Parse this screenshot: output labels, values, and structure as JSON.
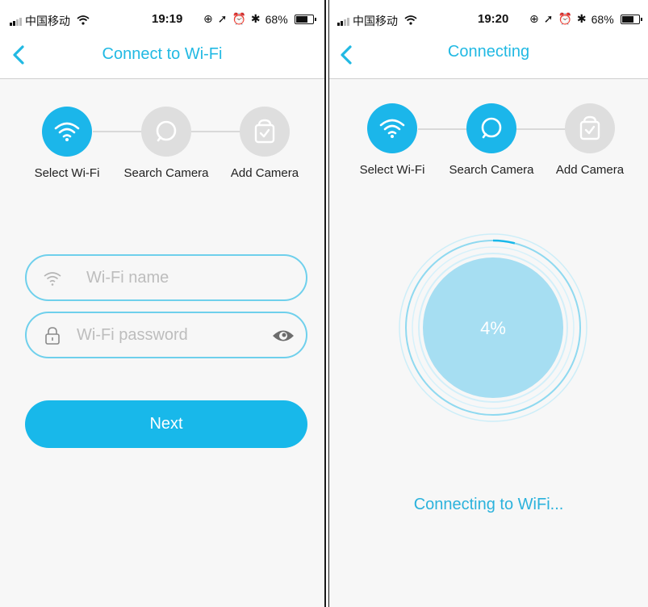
{
  "colors": {
    "accent": "#18b8ea",
    "title": "#21b9e3",
    "progress_fill": "#a6def2",
    "ring": "#7dd4ee",
    "inactive_step": "#dedede"
  },
  "left_screen": {
    "status_bar": {
      "carrier": "中国移动",
      "time": "19:19",
      "battery": "68%"
    },
    "header": {
      "back_icon": "chevron-left-icon",
      "title": "Connect to Wi-Fi"
    },
    "steps": [
      {
        "label": "Select Wi-Fi",
        "icon": "wifi-icon",
        "active": true
      },
      {
        "label": "Search Camera",
        "icon": "search-icon",
        "active": false
      },
      {
        "label": "Add Camera",
        "icon": "shield-check-icon",
        "active": false
      }
    ],
    "form": {
      "wifi_name": {
        "placeholder": "Wi-Fi name",
        "value": ""
      },
      "wifi_password": {
        "placeholder": "Wi-Fi password",
        "value": ""
      }
    },
    "next_label": "Next"
  },
  "right_screen": {
    "status_bar": {
      "carrier": "中国移动",
      "time": "19:20",
      "battery": "68%"
    },
    "header": {
      "back_icon": "chevron-left-icon",
      "title": "Connecting"
    },
    "steps": [
      {
        "label": "Select Wi-Fi",
        "icon": "wifi-icon",
        "active": true
      },
      {
        "label": "Search Camera",
        "icon": "search-icon",
        "active": true
      },
      {
        "label": "Add Camera",
        "icon": "shield-check-icon",
        "active": false
      }
    ],
    "progress": {
      "percent": 4,
      "label": "4%"
    },
    "status_text": "Connecting to WiFi..."
  }
}
